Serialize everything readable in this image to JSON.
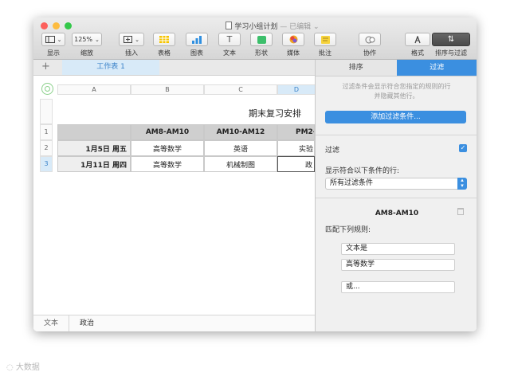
{
  "window": {
    "title": "学习小组计划",
    "title_suffix": "— 已编辑",
    "traffic_lights": [
      "#fc605c",
      "#fdbc40",
      "#34c84a"
    ]
  },
  "toolbar": {
    "view": {
      "label": "显示",
      "icon": "view-sidebar-icon"
    },
    "zoom": {
      "label": "缩放",
      "value": "125%"
    },
    "insert": {
      "label": "插入",
      "icon": "insert-icon"
    },
    "table": {
      "label": "表格",
      "icon": "table-icon"
    },
    "chart": {
      "label": "图表",
      "icon": "chart-icon"
    },
    "text": {
      "label": "文本",
      "icon": "text-icon"
    },
    "shape": {
      "label": "形状",
      "icon": "shape-icon"
    },
    "media": {
      "label": "媒体",
      "icon": "media-icon"
    },
    "comment": {
      "label": "批注",
      "icon": "comment-icon"
    },
    "collaborate": {
      "label": "协作",
      "icon": "collaborate-icon"
    },
    "format": {
      "label": "格式",
      "icon": "format-brush-icon"
    },
    "sort_filter": {
      "label": "排序与过滤",
      "icon": "sort-arrows-icon"
    }
  },
  "sheet": {
    "tab_name": "工作表 1",
    "column_headers": [
      "A",
      "B",
      "C",
      "D"
    ],
    "row_numbers": [
      "1",
      "2",
      "3"
    ],
    "table_title": "期末复习安排",
    "header_row": [
      "",
      "AM8-AM10",
      "AM10-AM12",
      "PM2-"
    ],
    "rows": [
      [
        "1月5日 周五",
        "高等数学",
        "英语",
        "实验"
      ],
      [
        "1月11日 周四",
        "高等数学",
        "机械制图",
        "政"
      ]
    ]
  },
  "bottom_bar": {
    "format_label": "文本",
    "cell_value": "政治"
  },
  "panel": {
    "tabs": [
      "排序",
      "过滤"
    ],
    "active_tab": "过滤",
    "description_line1": "过滤条件会显示符合您指定的规则的行",
    "description_line2": "并隐藏其他行。",
    "add_filter_button": "添加过滤条件...",
    "filter_label": "过滤",
    "filter_checked": true,
    "show_rows_label": "显示符合以下条件的行:",
    "show_rows_value": "所有过滤条件",
    "rule": {
      "column": "AM8-AM10",
      "match_label": "匹配下列规则:",
      "condition": "文本是",
      "value": "高等数学",
      "or_label": "或..."
    }
  },
  "watermark": "大数据"
}
